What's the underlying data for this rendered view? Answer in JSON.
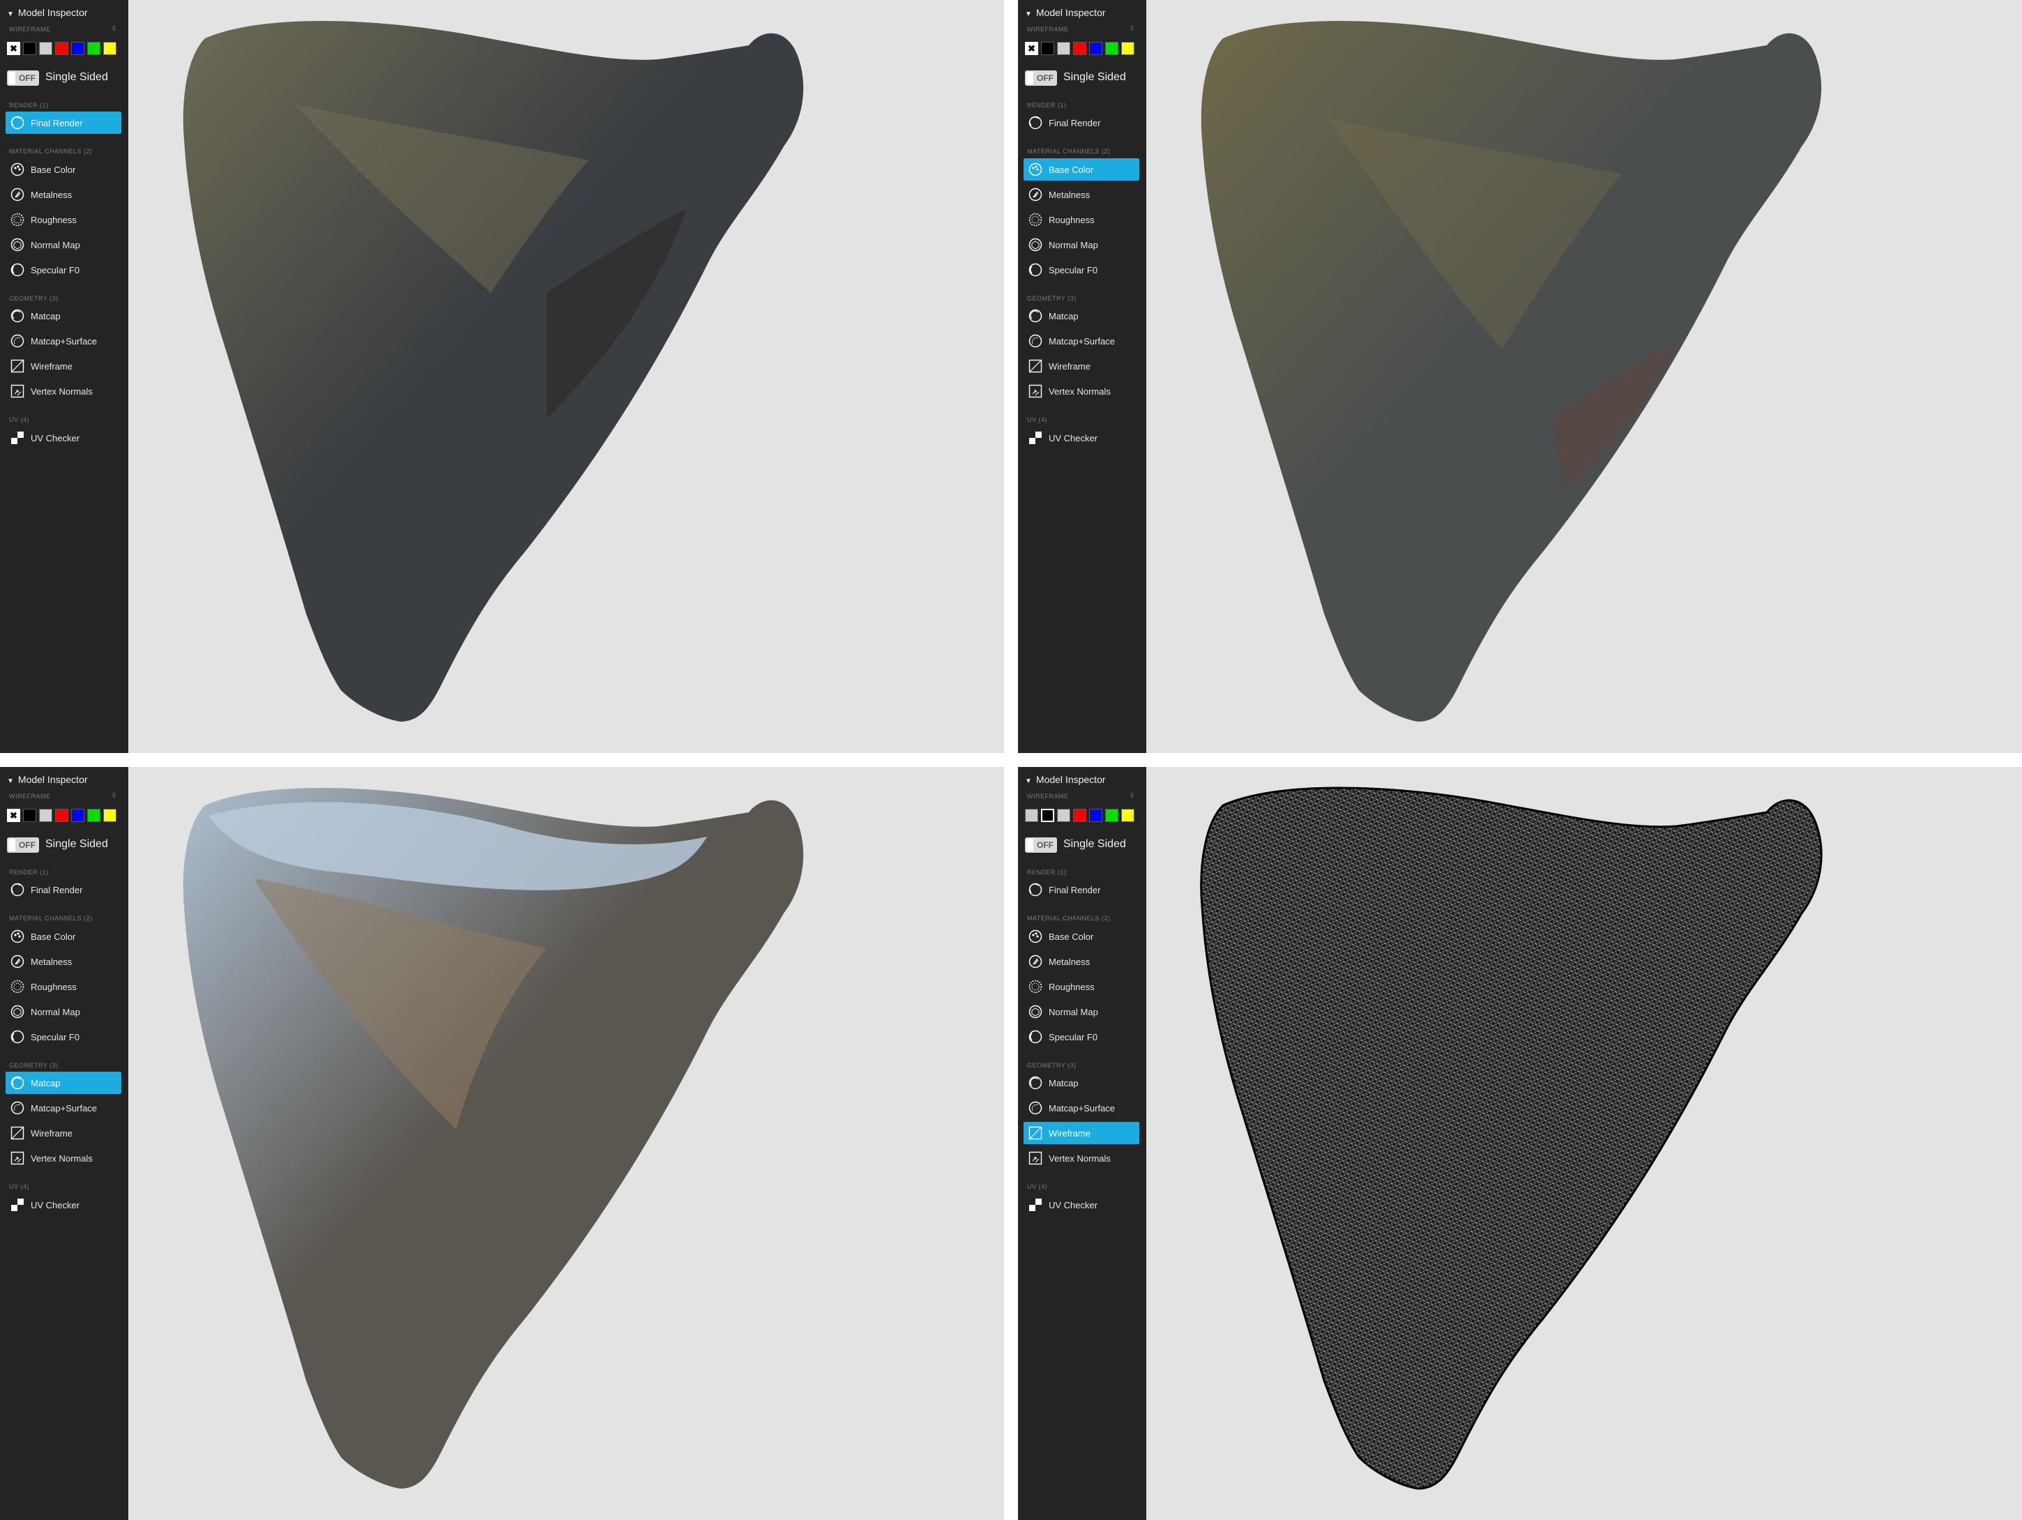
{
  "panel": {
    "title": "Model Inspector",
    "wireframe_section": "WIREFRAME",
    "wireframe_count": "5",
    "swatch_colors": [
      "#ffffff",
      "#000000",
      "#d0d0d0",
      "#ff0000",
      "#0000ff",
      "#00e000",
      "#ffff00"
    ],
    "toggle_state": "OFF",
    "toggle_label": "Single Sided",
    "sections": {
      "render": "RENDER (1)",
      "material": "MATERIAL CHANNELS (2)",
      "geometry": "GEOMETRY (3)",
      "uv": "UV (4)"
    },
    "items": {
      "final_render": "Final Render",
      "base_color": "Base Color",
      "metalness": "Metalness",
      "roughness": "Roughness",
      "normal_map": "Normal Map",
      "specular_f0": "Specular F0",
      "matcap": "Matcap",
      "matcap_surface": "Matcap+Surface",
      "wireframe": "Wireframe",
      "vertex_normals": "Vertex Normals",
      "uv_checker": "UV Checker"
    }
  },
  "views": [
    {
      "id": "tl",
      "active_item": "final_render",
      "render_mode": "final-render",
      "colors": {
        "fill": "#3a3d41",
        "highlight": "#6e6b55"
      }
    },
    {
      "id": "tr",
      "active_item": "base_color",
      "render_mode": "base-color",
      "colors": {
        "fill": "#4a4e4e",
        "highlight": "#6f6a4a"
      }
    },
    {
      "id": "bl",
      "active_item": "matcap",
      "render_mode": "matcap",
      "colors": {
        "fill": "#5a5650",
        "highlight": "#aebfd0"
      }
    },
    {
      "id": "br",
      "active_item": "wireframe",
      "render_mode": "wireframe",
      "colors": {
        "fill": "#0a0a0a",
        "highlight": "#3a3a3a"
      }
    }
  ],
  "accent_color": "#1cace0"
}
